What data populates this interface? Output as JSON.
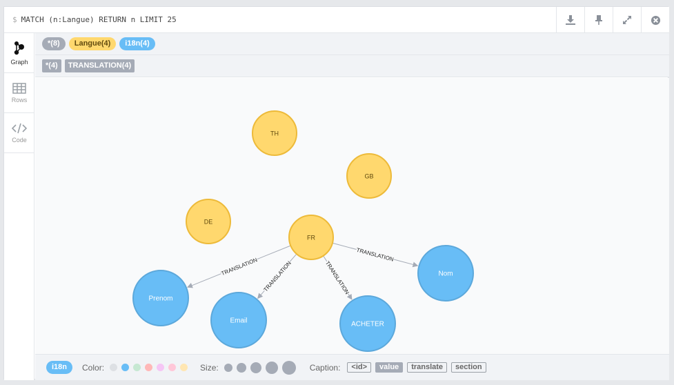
{
  "query": {
    "prompt": "$",
    "text": "MATCH (n:Langue) RETURN n LIMIT 25"
  },
  "toolbar": {
    "icons": [
      "download-icon",
      "pin-icon",
      "expand-icon",
      "close-icon"
    ]
  },
  "sidebar": {
    "items": [
      {
        "label": "Graph",
        "icon": "graph-icon",
        "active": true
      },
      {
        "label": "Rows",
        "icon": "table-icon",
        "active": false
      },
      {
        "label": "Code",
        "icon": "code-icon",
        "active": false
      }
    ]
  },
  "node_labels": {
    "all": "*(8)",
    "langue": "Langue(4)",
    "i18n": "i18n(4)"
  },
  "rel_types": {
    "all": "*(4)",
    "translation": "TRANSLATION(4)"
  },
  "graph": {
    "nodes": [
      {
        "id": "TH",
        "caption": "TH",
        "label": "Langue"
      },
      {
        "id": "GB",
        "caption": "GB",
        "label": "Langue"
      },
      {
        "id": "DE",
        "caption": "DE",
        "label": "Langue"
      },
      {
        "id": "FR",
        "caption": "FR",
        "label": "Langue"
      },
      {
        "id": "Prenom",
        "caption": "Prenom",
        "label": "i18n"
      },
      {
        "id": "Email",
        "caption": "Email",
        "label": "i18n"
      },
      {
        "id": "ACHETER",
        "caption": "ACHETER",
        "label": "i18n"
      },
      {
        "id": "Nom",
        "caption": "Nom",
        "label": "i18n"
      }
    ],
    "relationships": [
      {
        "from": "FR",
        "to": "Prenom",
        "type": "TRANSLATION"
      },
      {
        "from": "FR",
        "to": "Email",
        "type": "TRANSLATION"
      },
      {
        "from": "FR",
        "to": "ACHETER",
        "type": "TRANSLATION"
      },
      {
        "from": "FR",
        "to": "Nom",
        "type": "TRANSLATION"
      }
    ],
    "colors": {
      "Langue": "#ffd86e",
      "Langue_border": "#edba39",
      "i18n": "#68bdf6",
      "i18n_border": "#5ca8db",
      "rel": "#a5abb6"
    }
  },
  "footer": {
    "selected": "i18n",
    "color_label": "Color:",
    "colors": [
      "#dde0e4",
      "#68bdf6",
      "#c6e8d2",
      "#ffb8b8",
      "#f5c6f5",
      "#ffc7d8",
      "#ffe6b2"
    ],
    "size_label": "Size:",
    "caption_label": "Caption:",
    "captions": [
      "<id>",
      "value",
      "translate",
      "section"
    ],
    "active_caption": "value"
  }
}
